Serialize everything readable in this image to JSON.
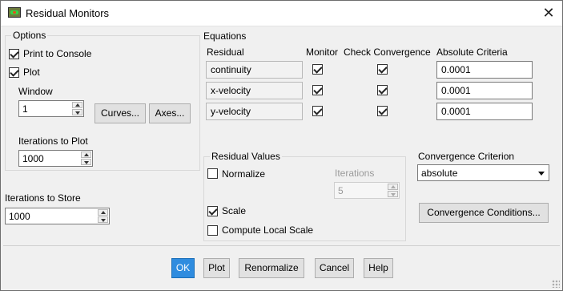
{
  "window": {
    "title": "Residual Monitors"
  },
  "options": {
    "legend": "Options",
    "print_to_console": {
      "label": "Print to Console",
      "checked": true
    },
    "plot": {
      "label": "Plot",
      "checked": true
    },
    "window_label": "Window",
    "window_value": "1",
    "curves_button": "Curves...",
    "axes_button": "Axes...",
    "iterations_to_plot_label": "Iterations to Plot",
    "iterations_to_plot_value": "1000"
  },
  "iterations_to_store": {
    "label": "Iterations to Store",
    "value": "1000"
  },
  "equations": {
    "title": "Equations",
    "headers": {
      "residual": "Residual",
      "monitor": "Monitor",
      "check_convergence": "Check Convergence",
      "absolute_criteria": "Absolute Criteria"
    },
    "rows": [
      {
        "residual": "continuity",
        "monitor": true,
        "check_convergence": true,
        "absolute_criteria": "0.0001"
      },
      {
        "residual": "x-velocity",
        "monitor": true,
        "check_convergence": true,
        "absolute_criteria": "0.0001"
      },
      {
        "residual": "y-velocity",
        "monitor": true,
        "check_convergence": true,
        "absolute_criteria": "0.0001"
      }
    ]
  },
  "residual_values": {
    "legend": "Residual Values",
    "normalize": {
      "label": "Normalize",
      "checked": false
    },
    "iterations_label": "Iterations",
    "iterations_value": "5",
    "scale": {
      "label": "Scale",
      "checked": true
    },
    "compute_local_scale": {
      "label": "Compute Local Scale",
      "checked": false
    }
  },
  "convergence_criterion": {
    "label": "Convergence Criterion",
    "selected": "absolute",
    "conditions_button": "Convergence Conditions..."
  },
  "footer": {
    "ok": "OK",
    "plot": "Plot",
    "renormalize": "Renormalize",
    "cancel": "Cancel",
    "help": "Help"
  },
  "colors": {
    "default_button": "#2f8cdf",
    "window_bg": "#f0f0f0"
  }
}
